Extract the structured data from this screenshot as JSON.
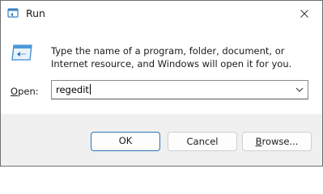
{
  "window": {
    "title": "Run",
    "close_label": "×"
  },
  "dialog": {
    "description": "Type the name of a program, folder, document, or Internet resource, and Windows will open it for you.",
    "open_label_mnemonic": "O",
    "open_label_rest": "pen:",
    "open_value": "regedit"
  },
  "buttons": {
    "ok": "OK",
    "cancel": "Cancel",
    "browse_mnemonic": "B",
    "browse_rest": "rowse..."
  },
  "icons": {
    "title_icon": "run-icon",
    "dialog_icon": "run-window-icon",
    "dropdown": "chevron-down-icon",
    "close": "close-icon"
  },
  "colors": {
    "accent": "#2d73b5",
    "footer_bg": "#f0f0f0"
  }
}
